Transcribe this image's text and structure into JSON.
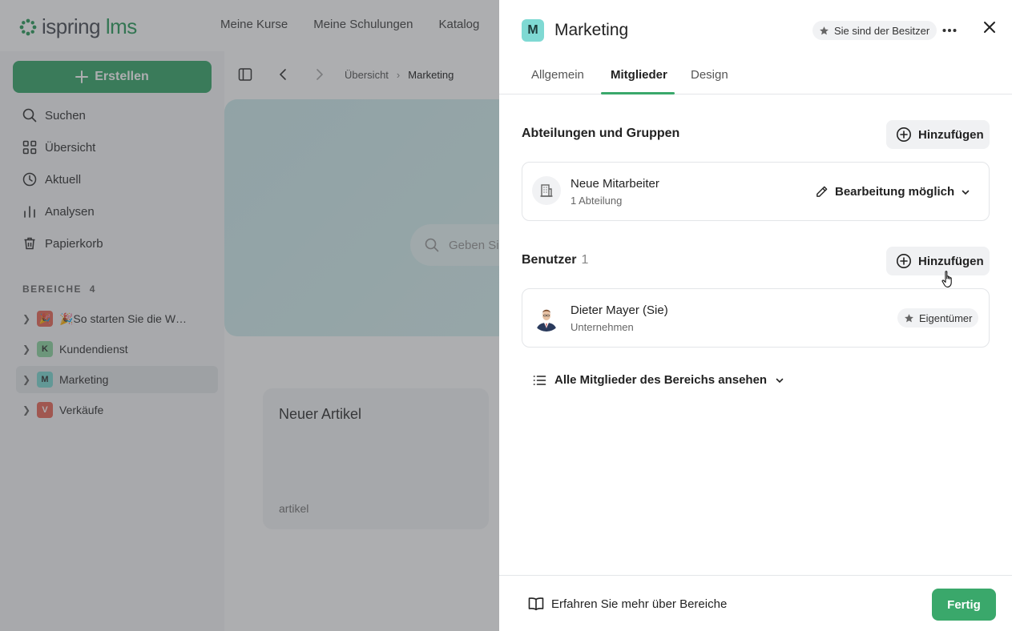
{
  "app": {
    "logo_main": "ispring",
    "logo_accent": "lms",
    "topnav": [
      "Meine Kurse",
      "Meine Schulungen",
      "Katalog"
    ],
    "create_label": "Erstellen",
    "nav": [
      {
        "label": "Suchen",
        "icon": "search-icon"
      },
      {
        "label": "Übersicht",
        "icon": "grid-icon"
      },
      {
        "label": "Aktuell",
        "icon": "clock-icon"
      },
      {
        "label": "Analysen",
        "icon": "bar-chart-icon"
      },
      {
        "label": "Papierkorb",
        "icon": "trash-icon"
      }
    ],
    "areas_label": "BEREICHE",
    "areas_count": "4",
    "areas": [
      {
        "badge": "🎉",
        "label": "🎉So starten Sie die W…",
        "color": "#e86a5a"
      },
      {
        "badge": "K",
        "label": "Kundendienst",
        "color": "#8fd6a3"
      },
      {
        "badge": "M",
        "label": "Marketing",
        "color": "#7fd9d3"
      },
      {
        "badge": "V",
        "label": "Verkäufe",
        "color": "#e86a5a"
      }
    ],
    "breadcrumb": [
      "Übersicht",
      "Marketing"
    ],
    "hero_search_placeholder": "Geben Si",
    "card": {
      "title": "Neuer Artikel",
      "subtitle": "artikel"
    }
  },
  "drawer": {
    "badge": "M",
    "title": "Marketing",
    "owner_chip": "Sie sind der Besitzer",
    "tabs": [
      "Allgemein",
      "Mitglieder",
      "Design"
    ],
    "active_tab": "Mitglieder",
    "groups": {
      "title": "Abteilungen und Gruppen",
      "add_label": "Hinzufügen",
      "item": {
        "name": "Neue Mitarbeiter",
        "sub": "1 Abteilung",
        "permission": "Bearbeitung möglich"
      }
    },
    "users": {
      "title": "Benutzer",
      "count": "1",
      "add_label": "Hinzufügen",
      "item": {
        "name": "Dieter Mayer (Sie)",
        "sub": "Unternehmen",
        "role": "Eigentümer"
      }
    },
    "all_members_label": "Alle Mitglieder des Bereichs ansehen",
    "footer": {
      "learn_label": "Erfahren Sie mehr über Bereiche",
      "done_label": "Fertig"
    }
  },
  "colors": {
    "accent": "#3aa86b",
    "badge_teal": "#7fd9d3",
    "overlay": "rgba(60,62,66,0.42)"
  }
}
